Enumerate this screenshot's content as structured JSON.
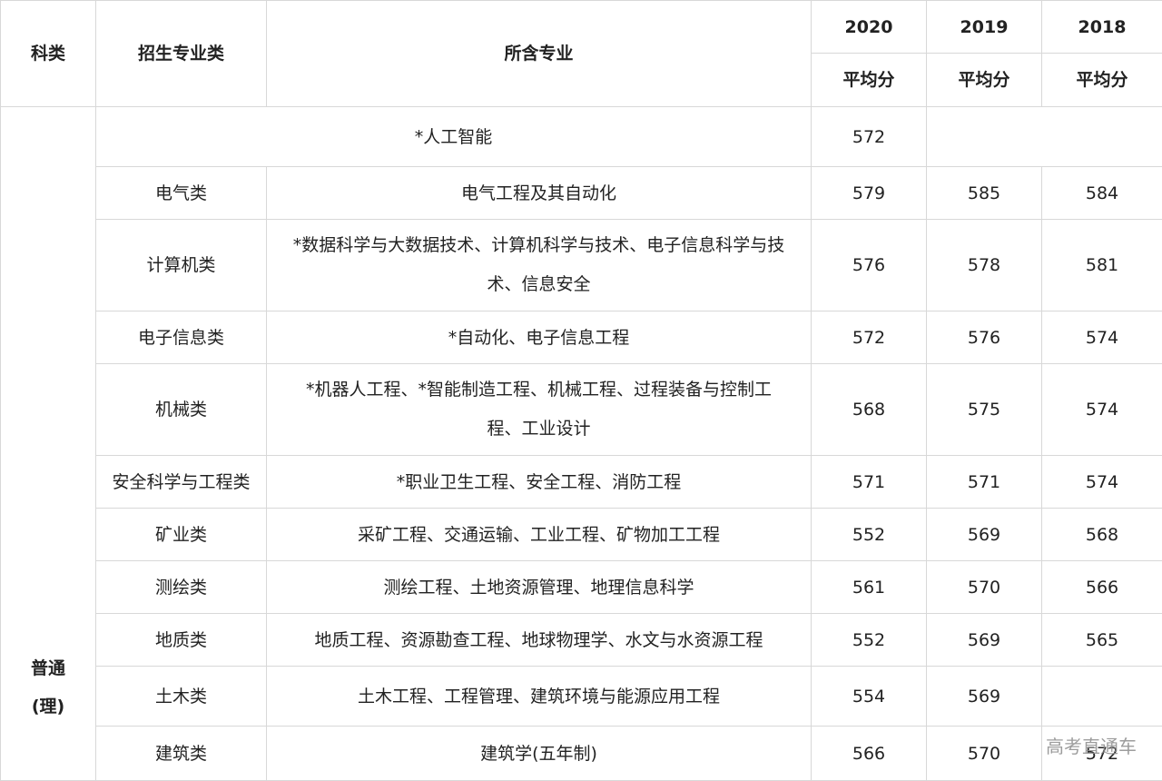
{
  "header": {
    "col_kelei": "科类",
    "col_zhuanyelei": "招生专业类",
    "col_suohan": "所含专业",
    "years": [
      "2020",
      "2019",
      "2018"
    ],
    "avg_label": "平均分"
  },
  "kelei_value_line1": "普通",
  "kelei_value_line2": "(理)",
  "rows": [
    {
      "category": "",
      "majors": "*人工智能",
      "s2020": "572",
      "s2019": "",
      "s2018": ""
    },
    {
      "category": "电气类",
      "majors": "电气工程及其自动化",
      "s2020": "579",
      "s2019": "585",
      "s2018": "584"
    },
    {
      "category": "计算机类",
      "majors_line1": "*数据科学与大数据技术、计算机科学与技术、电子信息科学与技",
      "majors_line2": "术、信息安全",
      "s2020": "576",
      "s2019": "578",
      "s2018": "581"
    },
    {
      "category": "电子信息类",
      "majors": "*自动化、电子信息工程",
      "s2020": "572",
      "s2019": "576",
      "s2018": "574"
    },
    {
      "category": "机械类",
      "majors_line1": "*机器人工程、*智能制造工程、机械工程、过程装备与控制工",
      "majors_line2": "程、工业设计",
      "s2020": "568",
      "s2019": "575",
      "s2018": "574"
    },
    {
      "category": "安全科学与工程类",
      "majors": "*职业卫生工程、安全工程、消防工程",
      "s2020": "571",
      "s2019": "571",
      "s2018": "574"
    },
    {
      "category": "矿业类",
      "majors": "采矿工程、交通运输、工业工程、矿物加工工程",
      "s2020": "552",
      "s2019": "569",
      "s2018": "568"
    },
    {
      "category": "测绘类",
      "majors": "测绘工程、土地资源管理、地理信息科学",
      "s2020": "561",
      "s2019": "570",
      "s2018": "566"
    },
    {
      "category": "地质类",
      "majors": "地质工程、资源勘查工程、地球物理学、水文与水资源工程",
      "s2020": "552",
      "s2019": "569",
      "s2018": "565"
    },
    {
      "category": "土木类",
      "majors": "土木工程、工程管理、建筑环境与能源应用工程",
      "s2020": "554",
      "s2019": "569",
      "s2018": ""
    },
    {
      "category": "建筑类",
      "majors": "建筑学(五年制)",
      "s2020": "566",
      "s2019": "570",
      "s2018": "572"
    }
  ],
  "watermark": "高考直通车"
}
